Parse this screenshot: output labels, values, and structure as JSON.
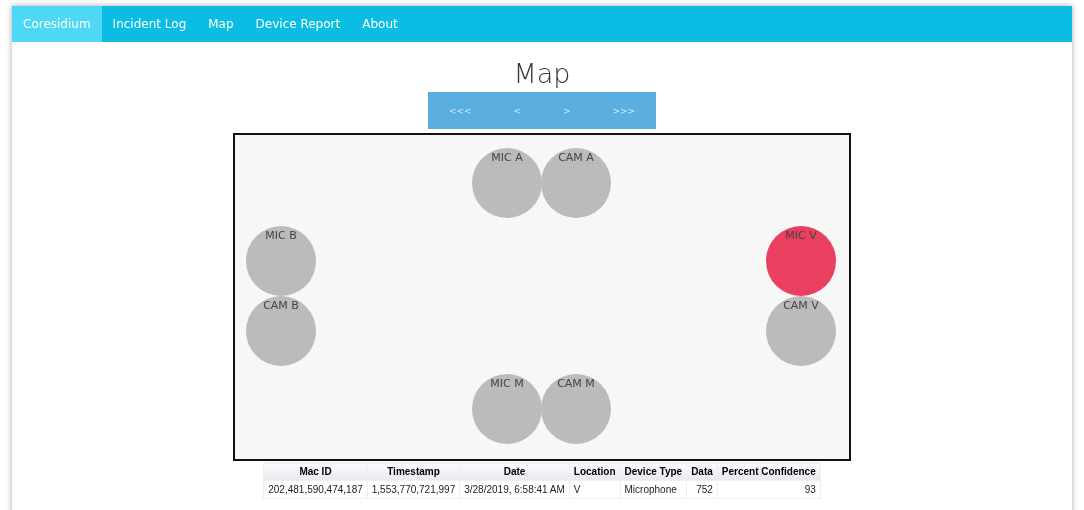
{
  "nav": {
    "items": [
      {
        "label": "Coresidium",
        "selected": true
      },
      {
        "label": "Incident Log",
        "selected": false
      },
      {
        "label": "Map",
        "selected": false
      },
      {
        "label": "Device Report",
        "selected": false
      },
      {
        "label": "About",
        "selected": false
      }
    ]
  },
  "page_title": "Map",
  "pager": [
    "<<<",
    "<",
    ">",
    ">>>"
  ],
  "map": {
    "devices": [
      {
        "label": "MIC A",
        "active": false
      },
      {
        "label": "CAM A",
        "active": false
      },
      {
        "label": "MIC B",
        "active": false
      },
      {
        "label": "CAM B",
        "active": false
      },
      {
        "label": "MIC V",
        "active": true
      },
      {
        "label": "CAM V",
        "active": false
      },
      {
        "label": "MIC M",
        "active": false
      },
      {
        "label": "CAM M",
        "active": false
      }
    ]
  },
  "table": {
    "columns": [
      "Mac ID",
      "Timestamp",
      "Date",
      "Location",
      "Device Type",
      "Data",
      "Percent Confidence"
    ],
    "rows": [
      [
        "202,481,590,474,187",
        "1,553,770,721,997",
        "3/28/2019, 6:58:41 AM",
        "V",
        "Microphone",
        "752",
        "93"
      ]
    ]
  }
}
